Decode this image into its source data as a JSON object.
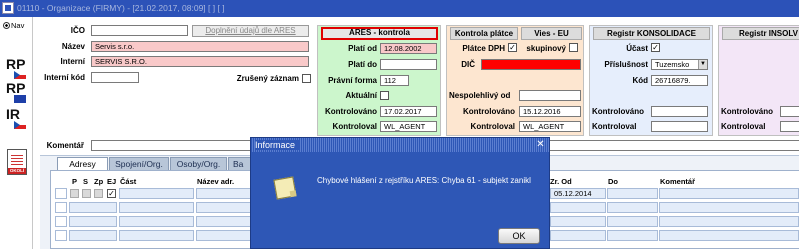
{
  "window": {
    "title": "01110 - Organizace (FIRMY) - [21.02.2017, 08:09] [ ] [ ]"
  },
  "rail": {
    "radio_label": "Nav",
    "buttons": [
      {
        "label": "RP",
        "flag": "cz-flag-icon"
      },
      {
        "label": "RP",
        "flag": "eu-flag-icon"
      },
      {
        "label": "IR",
        "flag": "cz-flag-icon"
      }
    ],
    "doc_caption": "OKOLÍ"
  },
  "form": {
    "ico_label": "IČO",
    "ico_value": "",
    "ares_fill_button": "Doplnění údajů dle ARES",
    "nazev_label": "Název",
    "nazev_value": "Servis s.r.o.",
    "interni_label": "Interní",
    "interni_value": "SERVIS S.R.O.",
    "interni_kod_label": "Interní kód",
    "interni_kod_value": "",
    "zruseny_label": "Zrušený záznam",
    "komentar_label": "Komentář",
    "komentar_value": ""
  },
  "ares": {
    "title": "ARES - kontrola",
    "plati_od_label": "Platí od",
    "plati_od_value": "12.08.2002",
    "plati_do_label": "Platí do",
    "plati_do_value": "",
    "pravni_forma_label": "Právní forma",
    "pravni_forma_value": "112",
    "aktualni_label": "Aktuální",
    "kontrolovano_label": "Kontrolováno",
    "kontrolovano_value": "17.02.2017",
    "kontroloval_label": "Kontroloval",
    "kontroloval_value": "WL_AGENT"
  },
  "vat": {
    "title_left": "Kontrola plátce",
    "title_right": "Vies - EU",
    "platce_label": "Plátce DPH",
    "skupinovy_label": "skupinový",
    "dic_label": "DIČ",
    "dic_value": "",
    "nespolehlivy_label": "Nespolehlivý od",
    "nespolehlivy_value": "",
    "kontrolovano_label": "Kontrolováno",
    "kontrolovano_value": "15.12.2016",
    "kontroloval_label": "Kontroloval",
    "kontroloval_value": "WL_AGENT"
  },
  "konsolidace": {
    "title": "Registr KONSOLIDACE",
    "ucast_label": "Účast",
    "prislusnost_label": "Příslušnost",
    "prislusnost_value": "Tuzemsko",
    "kod_label": "Kód",
    "kod_value": "26716879.",
    "kontrolovano_label": "Kontrolováno",
    "kontroloval_label": "Kontroloval"
  },
  "insolvence": {
    "title": "Registr INSOLV",
    "kontrolovano_label": "Kontrolováno",
    "kontroloval_label": "Kontroloval"
  },
  "tabs": [
    {
      "label": "Adresy"
    },
    {
      "label": "Spojení/Org."
    },
    {
      "label": "Osoby/Org."
    },
    {
      "label": "Ba"
    }
  ],
  "grid": {
    "headers": {
      "p": "P",
      "s": "S",
      "zp": "Zp",
      "ej": "EJ",
      "cast": "Část",
      "nazev_adr": "Název adr.",
      "zr_od": "Zr. Od",
      "do": "Do",
      "komentar": "Komentář"
    },
    "rows": [
      {
        "zr_od": "05.12.2014"
      },
      {
        "zr_od": ""
      },
      {
        "zr_od": ""
      },
      {
        "zr_od": ""
      }
    ]
  },
  "dialog": {
    "title": "Informace",
    "message": "Chybové hlášení z rejstříku ARES: Chyba 61 - subjekt zanikl",
    "ok_label": "OK"
  }
}
